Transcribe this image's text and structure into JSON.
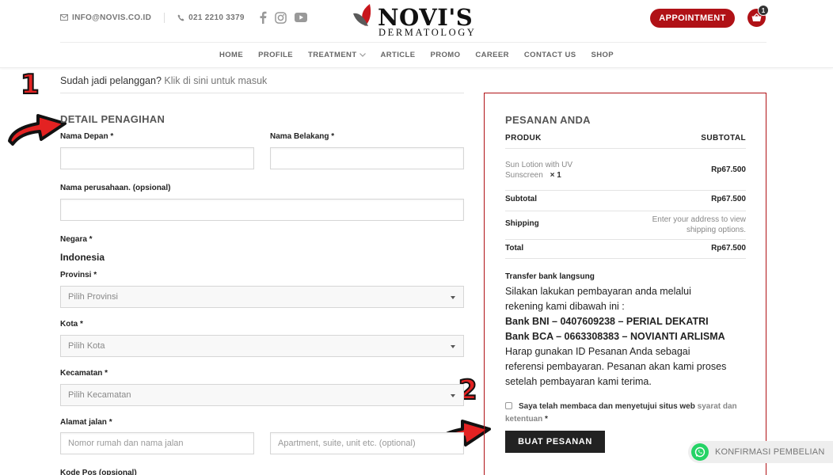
{
  "header": {
    "email": "INFO@NOVIS.CO.ID",
    "phone": "021 2210 3379",
    "logo_main": "NOVI'S",
    "logo_sub": "DERMATOLOGY",
    "appointment_label": "APPOINTMENT",
    "cart_count": "1",
    "nav": [
      "HOME",
      "PROFILE",
      "TREATMENT",
      "ARTICLE",
      "PROMO",
      "CAREER",
      "CONTACT US",
      "SHOP"
    ],
    "brand_color": "#b01116"
  },
  "login": {
    "prompt": "Sudah jadi pelanggan?",
    "link": "Klik di sini untuk masuk"
  },
  "markers": {
    "one": "1",
    "two": "2"
  },
  "billing": {
    "title": "DETAIL PENAGIHAN",
    "first_name_label": "Nama Depan *",
    "last_name_label": "Nama Belakang *",
    "company_label": "Nama perusahaan. (opsional)",
    "country_label": "Negara *",
    "country_value": "Indonesia",
    "province_label": "Provinsi *",
    "province_placeholder": "Pilih Provinsi",
    "city_label": "Kota *",
    "city_placeholder": "Pilih Kota",
    "district_label": "Kecamatan *",
    "district_placeholder": "Pilih Kecamatan",
    "address_label": "Alamat jalan *",
    "address_placeholder_1": "Nomor rumah dan nama jalan",
    "address_placeholder_2": "Apartment, suite, unit etc. (optional)",
    "postcode_label": "Kode Pos (opsional)"
  },
  "order": {
    "title": "PESANAN ANDA",
    "col_product": "PRODUK",
    "col_subtotal": "SUBTOTAL",
    "item_name_line1": "Sun Lotion with UV",
    "item_name_line2": "Sunscreen",
    "item_qty": "× 1",
    "item_price": "Rp67.500",
    "subtotal_label": "Subtotal",
    "subtotal_value": "Rp67.500",
    "shipping_label": "Shipping",
    "shipping_note_line1": "Enter your address to view",
    "shipping_note_line2": "shipping options.",
    "total_label": "Total",
    "total_value": "Rp67.500",
    "payment_title": "Transfer bank langsung",
    "payment_line1": "Silakan lakukan pembayaran anda melalui",
    "payment_line2": "rekening kami dibawah ini :",
    "bank1": "Bank BNI – 0407609238 – PERIAL DEKATRI",
    "bank2": "Bank BCA – 0663308383 – NOVIANTI ARLISMA",
    "payment_line3": "Harap gunakan ID Pesanan Anda sebagai",
    "payment_line4": "referensi pembayaran. Pesanan akan kami proses",
    "payment_line5": "setelah pembayaran kami terima.",
    "terms_text": "Saya telah membaca dan menyetujui situs web",
    "terms_link": "syarat dan ketentuan",
    "terms_required": "*",
    "place_order_label": "BUAT PESANAN"
  },
  "whatsapp": {
    "label": "KONFIRMASI PEMBELIAN",
    "color": "#25d366"
  }
}
